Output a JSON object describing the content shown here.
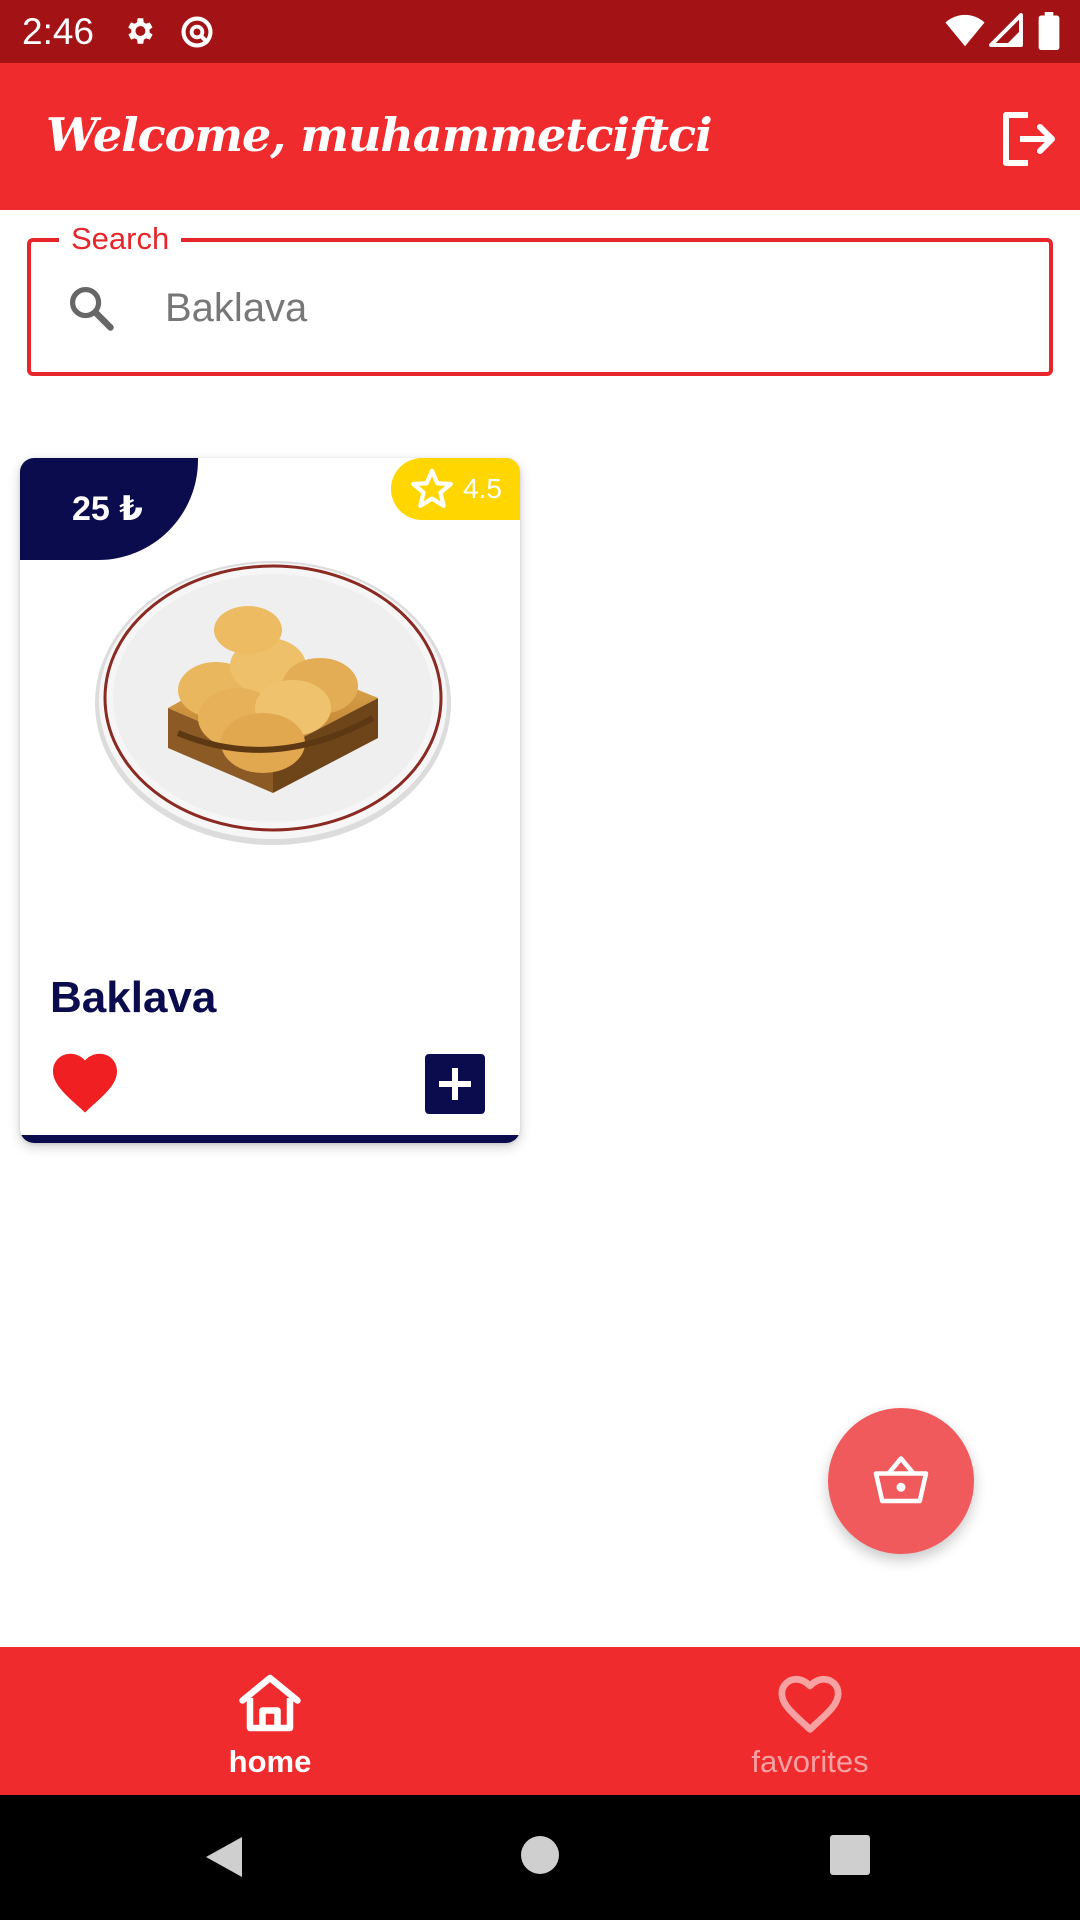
{
  "status_bar": {
    "time": "2:46",
    "icons": [
      "gear-icon",
      "data-saver-icon",
      "wifi-icon",
      "signal-icon",
      "battery-icon"
    ]
  },
  "app_bar": {
    "title": "Welcome, muhammetciftci",
    "action_icon": "logout-icon"
  },
  "search": {
    "label": "Search",
    "value": "Baklava",
    "icon": "search-icon"
  },
  "products": [
    {
      "name": "Baklava",
      "price": "25 ₺",
      "rating": "4.5",
      "favorite": true,
      "image": "baklava-plate",
      "add_icon": "plus-icon"
    }
  ],
  "fab": {
    "icon": "shopping-basket-icon"
  },
  "bottom_nav": {
    "items": [
      {
        "label": "home",
        "icon": "home-icon",
        "active": true
      },
      {
        "label": "favorites",
        "icon": "heart-outline-icon",
        "active": false
      }
    ]
  },
  "system_nav": {
    "buttons": [
      "back-icon",
      "home-circle-icon",
      "recents-icon"
    ]
  },
  "colors": {
    "primary": "#ef2b2d",
    "status_bar": "#a31315",
    "navy": "#0a0c4d",
    "rating": "#ffd600",
    "fab": "#f15a5c"
  }
}
